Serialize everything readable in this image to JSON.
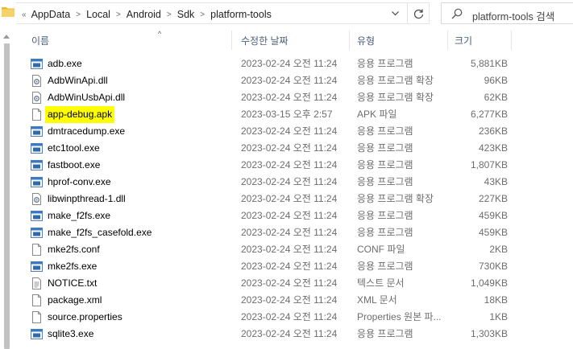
{
  "address": {
    "segments": [
      "AppData",
      "Local",
      "Android",
      "Sdk",
      "platform-tools"
    ]
  },
  "search": {
    "placeholder": "platform-tools 검색"
  },
  "columns": {
    "name": "이름",
    "date": "수정한 날짜",
    "type": "유형",
    "size": "크기"
  },
  "files": [
    {
      "name": "adb.exe",
      "date": "2023-02-24 오전 11:24",
      "type": "응용 프로그램",
      "size": "5,881KB",
      "icon": "exe-icon"
    },
    {
      "name": "AdbWinApi.dll",
      "date": "2023-02-24 오전 11:24",
      "type": "응용 프로그램 확장",
      "size": "96KB",
      "icon": "dll-icon"
    },
    {
      "name": "AdbWinUsbApi.dll",
      "date": "2023-02-24 오전 11:24",
      "type": "응용 프로그램 확장",
      "size": "62KB",
      "icon": "dll-icon"
    },
    {
      "name": "app-debug.apk",
      "date": "2023-03-15 오후 2:57",
      "type": "APK 파일",
      "size": "6,277KB",
      "icon": "file-icon",
      "highlight": true
    },
    {
      "name": "dmtracedump.exe",
      "date": "2023-02-24 오전 11:24",
      "type": "응용 프로그램",
      "size": "236KB",
      "icon": "exe-icon"
    },
    {
      "name": "etc1tool.exe",
      "date": "2023-02-24 오전 11:24",
      "type": "응용 프로그램",
      "size": "423KB",
      "icon": "exe-icon"
    },
    {
      "name": "fastboot.exe",
      "date": "2023-02-24 오전 11:24",
      "type": "응용 프로그램",
      "size": "1,807KB",
      "icon": "exe-icon"
    },
    {
      "name": "hprof-conv.exe",
      "date": "2023-02-24 오전 11:24",
      "type": "응용 프로그램",
      "size": "43KB",
      "icon": "exe-icon"
    },
    {
      "name": "libwinpthread-1.dll",
      "date": "2023-02-24 오전 11:24",
      "type": "응용 프로그램 확장",
      "size": "227KB",
      "icon": "dll-icon"
    },
    {
      "name": "make_f2fs.exe",
      "date": "2023-02-24 오전 11:24",
      "type": "응용 프로그램",
      "size": "459KB",
      "icon": "exe-icon"
    },
    {
      "name": "make_f2fs_casefold.exe",
      "date": "2023-02-24 오전 11:24",
      "type": "응용 프로그램",
      "size": "459KB",
      "icon": "exe-icon"
    },
    {
      "name": "mke2fs.conf",
      "date": "2023-02-24 오전 11:24",
      "type": "CONF 파일",
      "size": "2KB",
      "icon": "file-icon"
    },
    {
      "name": "mke2fs.exe",
      "date": "2023-02-24 오전 11:24",
      "type": "응용 프로그램",
      "size": "730KB",
      "icon": "exe-icon"
    },
    {
      "name": "NOTICE.txt",
      "date": "2023-02-24 오전 11:24",
      "type": "텍스트 문서",
      "size": "1,049KB",
      "icon": "text-icon"
    },
    {
      "name": "package.xml",
      "date": "2023-02-24 오전 11:24",
      "type": "XML 문서",
      "size": "18KB",
      "icon": "file-icon"
    },
    {
      "name": "source.properties",
      "date": "2023-02-24 오전 11:24",
      "type": "Properties 원본 파...",
      "size": "1KB",
      "icon": "file-icon"
    },
    {
      "name": "sqlite3.exe",
      "date": "2023-02-24 오전 11:24",
      "type": "응용 프로그램",
      "size": "1,303KB",
      "icon": "exe-icon"
    }
  ],
  "colors": {
    "highlight": "#ffff00",
    "header_text": "#4c607a",
    "exe_blue": "#2b6cb0"
  }
}
